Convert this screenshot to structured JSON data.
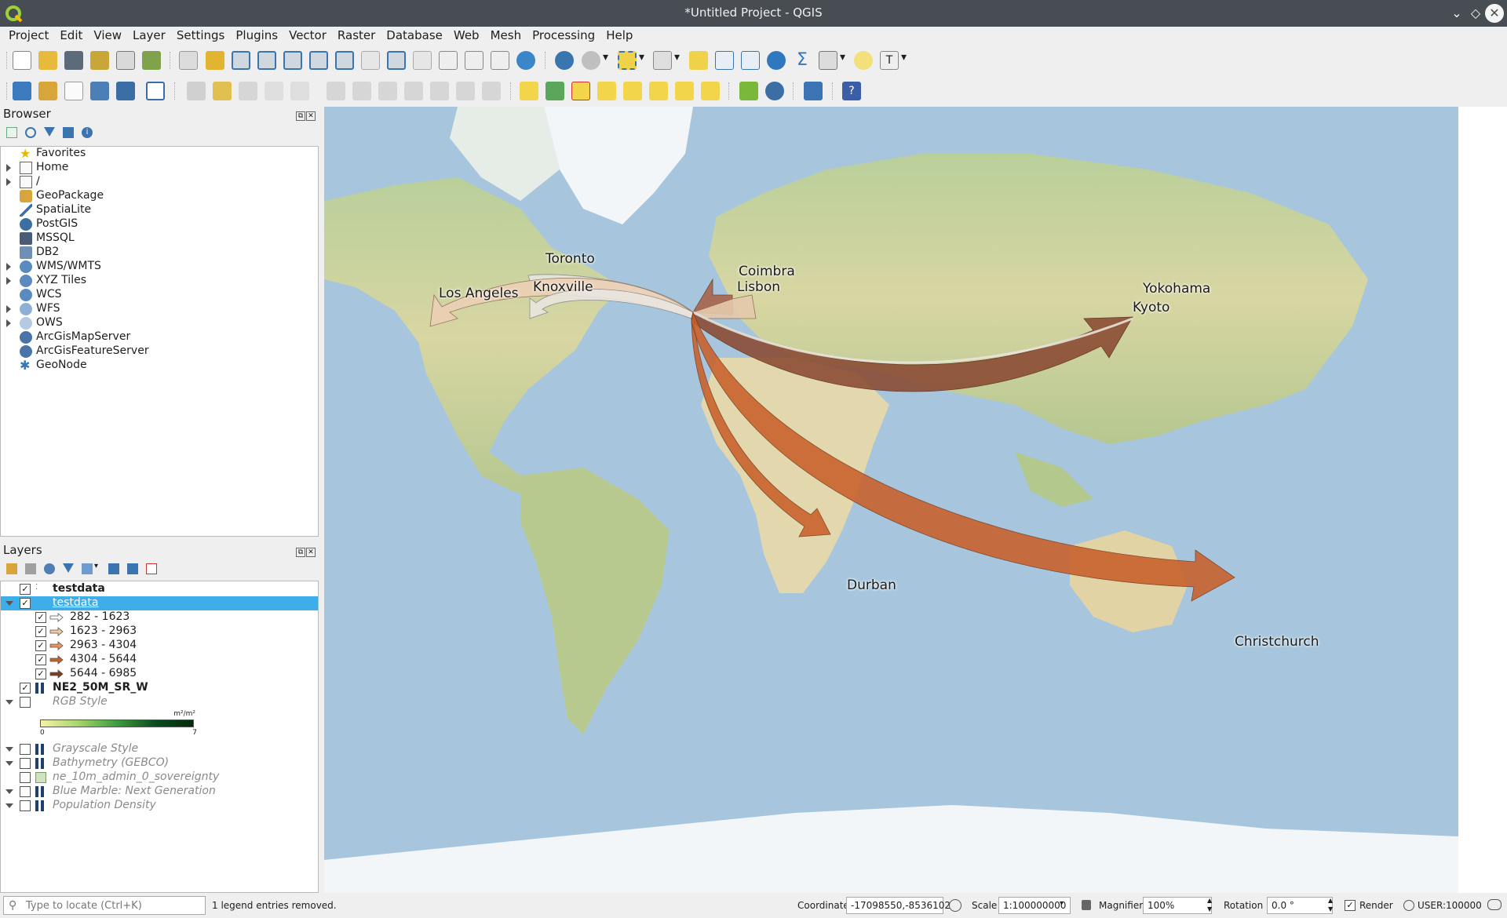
{
  "window": {
    "title": "*Untitled Project - QGIS"
  },
  "menu": [
    "Project",
    "Edit",
    "View",
    "Layer",
    "Settings",
    "Plugins",
    "Vector",
    "Raster",
    "Database",
    "Web",
    "Mesh",
    "Processing",
    "Help"
  ],
  "browser": {
    "title": "Browser",
    "items": [
      {
        "label": "Favorites",
        "expandable": false,
        "icon": "star-icon"
      },
      {
        "label": "Home",
        "expandable": true,
        "icon": "home-icon"
      },
      {
        "label": "/",
        "expandable": true,
        "icon": "folder-icon"
      },
      {
        "label": "GeoPackage",
        "expandable": false,
        "icon": "geopackage-icon"
      },
      {
        "label": "SpatiaLite",
        "expandable": false,
        "icon": "spatialite-icon"
      },
      {
        "label": "PostGIS",
        "expandable": false,
        "icon": "postgis-icon"
      },
      {
        "label": "MSSQL",
        "expandable": false,
        "icon": "mssql-icon"
      },
      {
        "label": "DB2",
        "expandable": false,
        "icon": "db2-icon"
      },
      {
        "label": "WMS/WMTS",
        "expandable": true,
        "icon": "wms-icon"
      },
      {
        "label": "XYZ Tiles",
        "expandable": true,
        "icon": "xyz-icon"
      },
      {
        "label": "WCS",
        "expandable": false,
        "icon": "wcs-icon"
      },
      {
        "label": "WFS",
        "expandable": true,
        "icon": "wfs-icon"
      },
      {
        "label": "OWS",
        "expandable": true,
        "icon": "ows-icon"
      },
      {
        "label": "ArcGisMapServer",
        "expandable": false,
        "icon": "arcgis-icon"
      },
      {
        "label": "ArcGisFeatureServer",
        "expandable": false,
        "icon": "arcgis-icon"
      },
      {
        "label": "GeoNode",
        "expandable": false,
        "icon": "geonode-icon"
      }
    ]
  },
  "layers": {
    "title": "Layers",
    "items": [
      {
        "label": "testdata",
        "checked": true,
        "style": "bold",
        "symbol": "points"
      },
      {
        "label": "testdata",
        "checked": true,
        "style": "selected",
        "symbol": "none",
        "expanded": true
      },
      {
        "label": "282 - 1623",
        "checked": true,
        "style": "class",
        "symbol": "arrow",
        "color": "#ffffff"
      },
      {
        "label": "1623 - 2963",
        "checked": true,
        "style": "class",
        "symbol": "arrow",
        "color": "#f2c8a4"
      },
      {
        "label": "2963 - 4304",
        "checked": true,
        "style": "class",
        "symbol": "arrow",
        "color": "#e9935a"
      },
      {
        "label": "4304 - 5644",
        "checked": true,
        "style": "class",
        "symbol": "arrow",
        "color": "#c8602a"
      },
      {
        "label": "5644 - 6985",
        "checked": true,
        "style": "class",
        "symbol": "arrow",
        "color": "#7a3c22"
      },
      {
        "label": "NE2_50M_SR_W",
        "checked": true,
        "style": "bold",
        "symbol": "raster"
      },
      {
        "label": "RGB Style",
        "checked": false,
        "style": "italic",
        "symbol": "none",
        "expanded": true
      },
      {
        "label": "Grayscale Style",
        "checked": false,
        "style": "italic",
        "symbol": "raster",
        "expanded": true
      },
      {
        "label": "Bathymetry (GEBCO)",
        "checked": false,
        "style": "italic",
        "symbol": "raster",
        "expanded": true
      },
      {
        "label": "ne_10m_admin_0_sovereignty",
        "checked": false,
        "style": "italic",
        "symbol": "polygon"
      },
      {
        "label": "Blue Marble: Next Generation",
        "checked": false,
        "style": "italic",
        "symbol": "raster",
        "expanded": true
      },
      {
        "label": "Population Density",
        "checked": false,
        "style": "italic",
        "symbol": "raster",
        "expanded": true
      }
    ],
    "ramp": {
      "unit": "m²/m²",
      "min": "0",
      "max": "7"
    }
  },
  "map": {
    "labels": [
      "Toronto",
      "Los Angeles",
      "Knoxville",
      "Coimbra",
      "Lisbon",
      "Yokohama",
      "Kyoto",
      "Durban",
      "Christchurch"
    ],
    "colors": {
      "ocean": "#a7c6dd",
      "land": "#c7d3a1",
      "ice": "#f3f6f8",
      "desert": "#e2d7ad",
      "forest": "#93b37a"
    }
  },
  "status": {
    "locator_placeholder": "Type to locate (Ctrl+K)",
    "message": "1 legend entries removed.",
    "coordinate_label": "Coordinate",
    "coordinate": "-17098550,-8536102",
    "scale_label": "Scale",
    "scale": "1:100000000",
    "magnifier_label": "Magnifier",
    "magnifier": "100%",
    "rotation_label": "Rotation",
    "rotation": "0.0 °",
    "render_label": "Render",
    "crs": "USER:100000"
  }
}
